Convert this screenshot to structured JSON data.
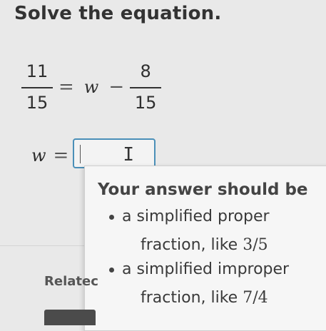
{
  "prompt": "Solve the equation.",
  "equation": {
    "lhs_num": "11",
    "lhs_den": "15",
    "equals": "=",
    "variable": "w",
    "minus": "−",
    "rhs_num": "8",
    "rhs_den": "15"
  },
  "answer": {
    "variable": "w",
    "equals": "=",
    "value": ""
  },
  "hint": {
    "title": "Your answer should be",
    "items": [
      {
        "line1": "a simplified proper",
        "line2_prefix": "fraction, like ",
        "example": "3/5"
      },
      {
        "line1": "a simplified improper",
        "line2_prefix": "fraction, like ",
        "example": "7/4"
      }
    ]
  },
  "related_label": "Relatec",
  "colors": {
    "input_border": "#4a8fb8",
    "background": "#e9e9e9"
  }
}
